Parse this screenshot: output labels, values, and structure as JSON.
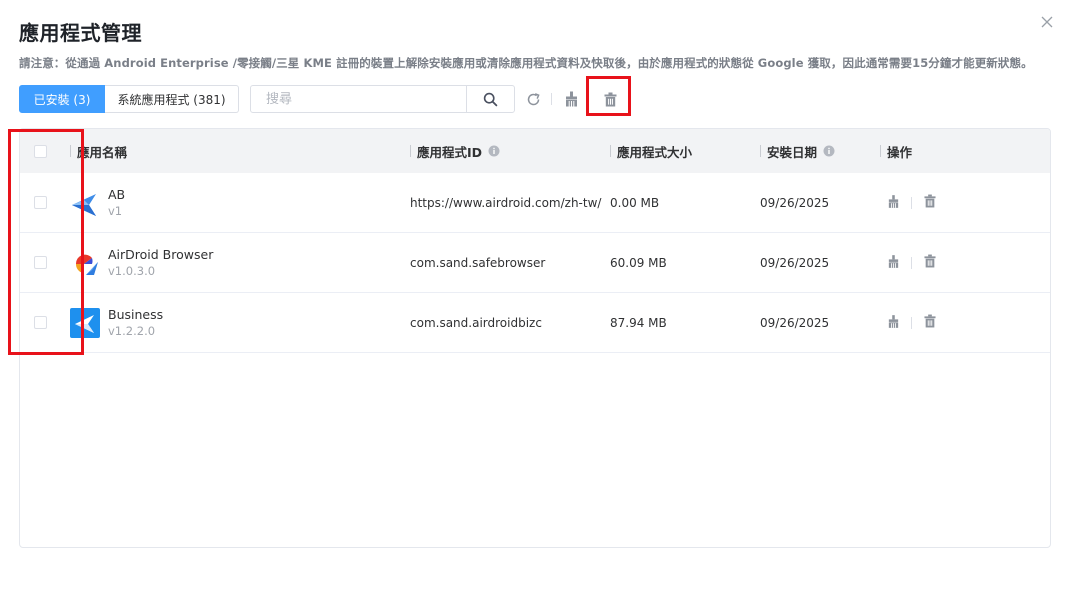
{
  "dialog": {
    "title": "應用程式管理",
    "notice": "請注意：從通過 Android Enterprise /零接觸/三星 KME 註冊的裝置上解除安裝應用或清除應用程式資料及快取後，由於應用程式的狀態從 Google 獲取，因此通常需要15分鐘才能更新狀態。"
  },
  "tabs": [
    {
      "label": "已安裝 (3)"
    },
    {
      "label": "系統應用程式 (381)"
    }
  ],
  "search": {
    "placeholder": "搜尋",
    "value": ""
  },
  "table": {
    "headers": {
      "name": "應用名稱",
      "id": "應用程式ID",
      "size": "應用程式大小",
      "date": "安裝日期",
      "actions": "操作"
    },
    "rows": [
      {
        "name": "AB",
        "version": "v1",
        "app_id": "https://www.airdroid.com/zh-tw/",
        "size": "0.00 MB",
        "install_date": "09/26/2025",
        "icon": "ab-app-icon"
      },
      {
        "name": "AirDroid Browser",
        "version": "v1.0.3.0",
        "app_id": "com.sand.safebrowser",
        "size": "60.09 MB",
        "install_date": "09/26/2025",
        "icon": "airdroid-browser-app-icon"
      },
      {
        "name": "Business",
        "version": "v1.2.2.0",
        "app_id": "com.sand.airdroidbizc",
        "size": "87.94 MB",
        "install_date": "09/26/2025",
        "icon": "business-app-icon"
      }
    ]
  },
  "colors": {
    "primary": "#409eff",
    "highlight": "#e8121a",
    "icon_gray": "#8d939c"
  }
}
